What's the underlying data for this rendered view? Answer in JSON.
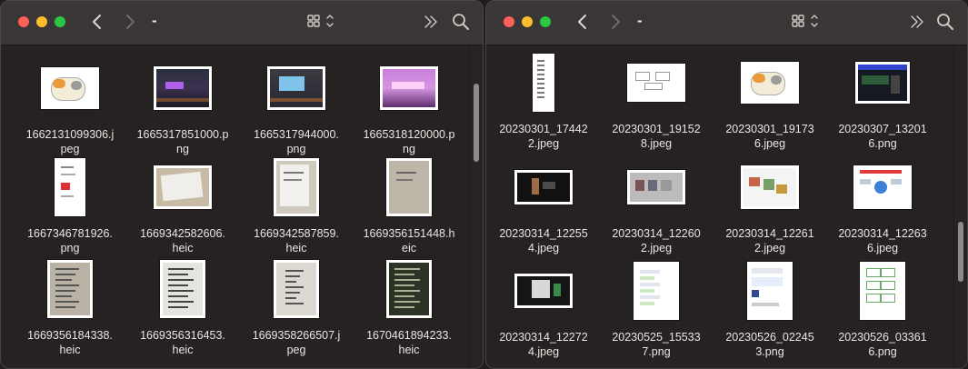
{
  "windows": [
    {
      "title": "-",
      "items": [
        {
          "name": "1662131099306.j\npeg",
          "thumb": "cat"
        },
        {
          "name": "1665317851000.p\nng",
          "thumb": "room-dark"
        },
        {
          "name": "1665317944000.\npng",
          "thumb": "room-monitor"
        },
        {
          "name": "1665318120000.p\nng",
          "thumb": "room-pink"
        },
        {
          "name": "1667346781926.\npng",
          "thumb": "doc-tall"
        },
        {
          "name": "1669342582606.\nheic",
          "thumb": "paper-desk"
        },
        {
          "name": "1669342587859.\nheic",
          "thumb": "paper-photo"
        },
        {
          "name": "1669356151448.h\neic",
          "thumb": "paper-gray"
        },
        {
          "name": "1669356184338.\nheic",
          "thumb": "paper-text"
        },
        {
          "name": "1669356316453.\nheic",
          "thumb": "paper-text2"
        },
        {
          "name": "1669358266507.j\npeg",
          "thumb": "paper-text3"
        },
        {
          "name": "1670461894233.\nheic",
          "thumb": "dark-doc"
        }
      ]
    },
    {
      "title": "-",
      "items": [
        {
          "name": "20230301_17442\n2.jpeg",
          "thumb": "strip"
        },
        {
          "name": "20230301_19152\n8.jpeg",
          "thumb": "diagram"
        },
        {
          "name": "20230301_19173\n6.jpeg",
          "thumb": "cat"
        },
        {
          "name": "20230307_13201\n6.png",
          "thumb": "app-dark"
        },
        {
          "name": "20230314_12255\n4.jpeg",
          "thumb": "video-dark"
        },
        {
          "name": "20230314_12260\n2.jpeg",
          "thumb": "slide-gray"
        },
        {
          "name": "20230314_12261\n2.jpeg",
          "thumb": "robots"
        },
        {
          "name": "20230314_12263\n6.jpeg",
          "thumb": "infographic"
        },
        {
          "name": "20230314_12272\n4.jpeg",
          "thumb": "video-dark2"
        },
        {
          "name": "20230525_15533\n7.png",
          "thumb": "doc-list"
        },
        {
          "name": "20230526_02245\n3.png",
          "thumb": "app-light"
        },
        {
          "name": "20230526_03361\n6.png",
          "thumb": "flowchart"
        }
      ]
    }
  ],
  "icons": {
    "back": "chevron-left-icon",
    "forward": "chevron-right-icon",
    "view": "icon-grid-view-icon",
    "more": "double-chevron-right-icon",
    "search": "search-icon"
  },
  "colors": {
    "close": "#fe5f57",
    "minimize": "#febc2e",
    "zoom": "#28c840",
    "toolbar": "#393635",
    "content": "#262221"
  },
  "scroll": {
    "left_fraction": 0.0,
    "right_fraction": 0.85
  }
}
